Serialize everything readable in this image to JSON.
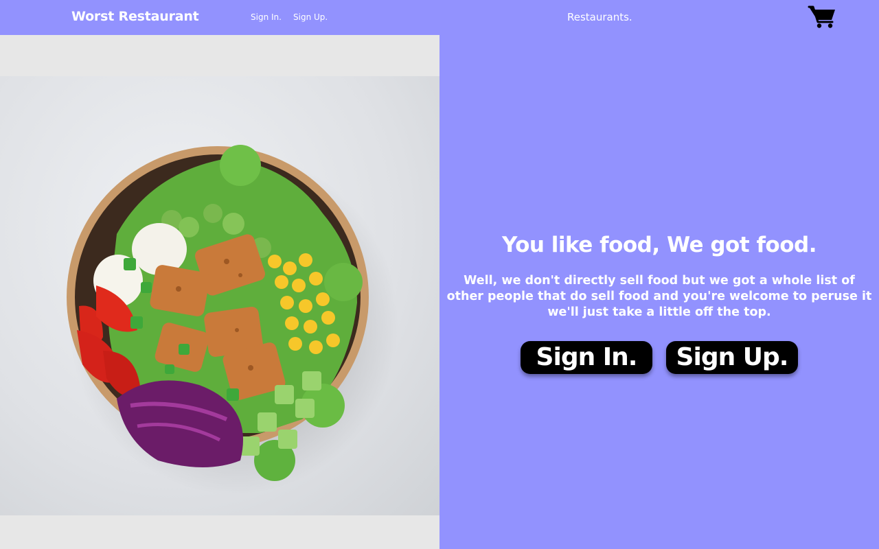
{
  "nav": {
    "brand": "Worst Restaurant",
    "sign_in": "Sign In.",
    "sign_up": "Sign Up.",
    "restaurants": "Restaurants.",
    "cart_icon": "shopping-cart-icon"
  },
  "hero": {
    "headline": "You like food, We got food.",
    "blurb": "Well, we don't directly sell food but we got a whole list of other people that do sell food and you're welcome to peruse it we'll just take a little off the top.",
    "sign_in_button": "Sign In.",
    "sign_up_button": "Sign Up."
  },
  "colors": {
    "accent": "#9292fe",
    "button": "#000000",
    "text": "#ffffff"
  }
}
